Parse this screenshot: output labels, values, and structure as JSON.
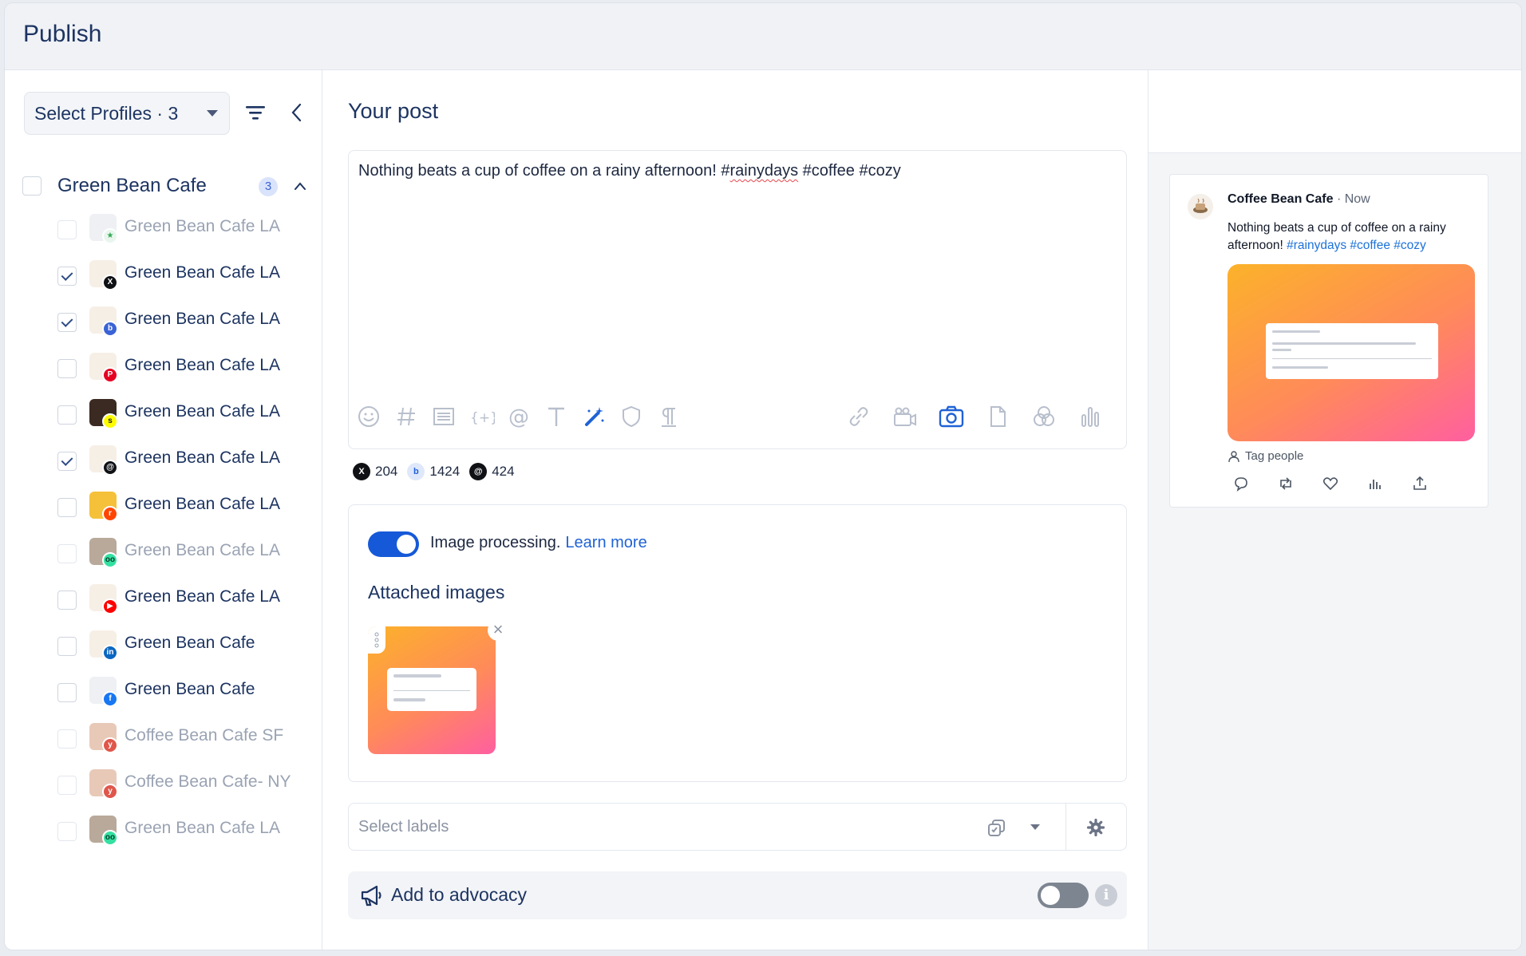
{
  "header": {
    "title": "Publish"
  },
  "sidebar": {
    "select_profiles": "Select Profiles · 3",
    "group": {
      "name": "Green Bean Cafe",
      "count": "3"
    },
    "profiles": [
      {
        "name": "Green Bean Cafe LA",
        "network": "google-business",
        "checked": false,
        "dim": true
      },
      {
        "name": "Green Bean Cafe LA",
        "network": "x",
        "checked": true,
        "dim": false
      },
      {
        "name": "Green Bean Cafe LA",
        "network": "bluesky",
        "checked": true,
        "dim": false
      },
      {
        "name": "Green Bean Cafe LA",
        "network": "pinterest",
        "checked": false,
        "dim": false
      },
      {
        "name": "Green Bean Cafe LA",
        "network": "snapchat",
        "checked": false,
        "dim": false
      },
      {
        "name": "Green Bean Cafe LA",
        "network": "threads",
        "checked": true,
        "dim": false
      },
      {
        "name": "Green Bean Cafe LA",
        "network": "reddit",
        "checked": false,
        "dim": false
      },
      {
        "name": "Green Bean Cafe LA",
        "network": "tripadvisor",
        "checked": false,
        "dim": true
      },
      {
        "name": "Green Bean Cafe LA",
        "network": "youtube",
        "checked": false,
        "dim": false
      },
      {
        "name": "Green Bean Cafe",
        "network": "linkedin",
        "checked": false,
        "dim": false
      },
      {
        "name": "Green Bean Cafe",
        "network": "facebook-page",
        "checked": false,
        "dim": false
      },
      {
        "name": "Coffee Bean Cafe SF",
        "network": "yelp",
        "checked": false,
        "dim": true
      },
      {
        "name": "Coffee Bean Cafe- NY",
        "network": "yelp",
        "checked": false,
        "dim": true
      },
      {
        "name": "Green Bean Cafe LA",
        "network": "tripadvisor",
        "checked": false,
        "dim": true
      }
    ]
  },
  "composer": {
    "title": "Your post",
    "text_before": "Nothing beats a cup of coffee on a rainy afternoon! #",
    "text_underlined": "rainydays",
    "text_after": " #coffee #cozy",
    "counts": [
      {
        "network": "X",
        "value": "204"
      },
      {
        "network": "Bluesky",
        "value": "1424"
      },
      {
        "network": "Threads",
        "value": "424"
      }
    ],
    "image_processing": "Image processing.",
    "learn_more": "Learn more",
    "attached_images": "Attached images",
    "labels_placeholder": "Select labels",
    "advocacy": "Add to advocacy"
  },
  "preview": {
    "account": "Coffee Bean Cafe",
    "time": "· Now",
    "text": "Nothing beats a cup of coffee on a rainy afternoon!",
    "hashtags": "#rainydays #coffee #cozy",
    "tag_people": "Tag people"
  },
  "colors": {
    "accent": "#1659d8",
    "navy": "#1d3461",
    "link": "#1d72d9"
  }
}
